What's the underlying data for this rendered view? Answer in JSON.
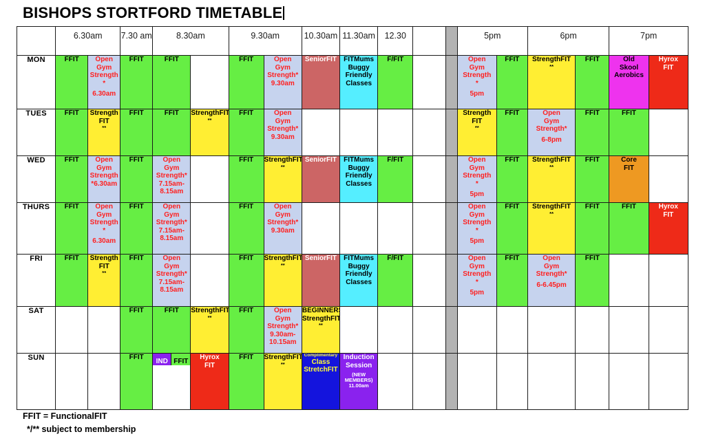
{
  "title": "BISHOPS STORTFORD TIMETABLE",
  "header": {
    "corner": "",
    "slots": [
      {
        "label": "6.30am",
        "span": 2
      },
      {
        "label": "7.30 am",
        "span": 1
      },
      {
        "label": "8.30am",
        "span": 2
      },
      {
        "label": "9.30am",
        "span": 2
      },
      {
        "label": "10.30am",
        "span": 1
      },
      {
        "label": "11.30am",
        "span": 1
      },
      {
        "label": "12.30",
        "span": 1
      },
      {
        "label": "",
        "span": 1
      },
      {
        "label": "",
        "span": 1,
        "divider": true
      },
      {
        "label": "5pm",
        "span": 2
      },
      {
        "label": "6pm",
        "span": 2
      },
      {
        "label": "7pm",
        "span": 2
      }
    ]
  },
  "colors": {
    "green": "#66ee44",
    "blue": "#c6d3ee",
    "yellow": "#ffee33",
    "rose": "#cc6565",
    "cyan": "#55eeff",
    "magenta": "#ee33ee",
    "red": "#ee2a18",
    "orange": "#ee9922",
    "purple": "#8a22ee",
    "navy": "#1414dd",
    "divider_grey": "#b3b3b3",
    "border": "#1a1a1a"
  },
  "rows": [
    {
      "day": "MON",
      "cells": [
        {
          "color": "green",
          "lines": [
            "FFIT"
          ]
        },
        {
          "color": "blue",
          "lines": [
            "Open",
            "Gym",
            "Strength",
            "*",
            "",
            "6.30am"
          ]
        },
        {
          "color": "green",
          "lines": [
            "FFIT"
          ]
        },
        {
          "color": "green",
          "lines": [
            "FFIT"
          ]
        },
        {
          "color": "white",
          "lines": []
        },
        {
          "color": "green",
          "lines": [
            "FFIT"
          ]
        },
        {
          "color": "blue",
          "lines": [
            "Open",
            "Gym",
            "Strength*",
            "9.30am"
          ]
        },
        {
          "color": "rose",
          "lines": [
            "SeniorFIT"
          ]
        },
        {
          "color": "cyan",
          "lines": [
            "FITMums",
            "Buggy",
            "Friendly",
            "Classes"
          ]
        },
        {
          "color": "green",
          "lines": [
            "F/FIT"
          ]
        },
        {
          "color": "white",
          "lines": []
        },
        {
          "divider": true
        },
        {
          "color": "blue",
          "lines": [
            "Open",
            "Gym",
            "Strength",
            "*",
            "",
            "5pm"
          ]
        },
        {
          "color": "green",
          "lines": [
            "FFIT"
          ]
        },
        {
          "color": "yellow",
          "lines": [
            "StrengthFIT"
          ],
          "sub": "**"
        },
        {
          "color": "green",
          "lines": [
            "FFIT"
          ]
        },
        {
          "color": "magenta",
          "lines": [
            "Old",
            "Skool",
            "Aerobics"
          ]
        },
        {
          "color": "red",
          "lines": [
            "Hyrox",
            "FIT"
          ]
        }
      ]
    },
    {
      "day": "TUES",
      "cells": [
        {
          "color": "green",
          "lines": [
            "FFIT"
          ]
        },
        {
          "color": "yellow",
          "lines": [
            "Strength",
            "FIT"
          ],
          "sub": "**"
        },
        {
          "color": "green",
          "lines": [
            "FFIT"
          ]
        },
        {
          "color": "green",
          "lines": [
            "FFIT"
          ]
        },
        {
          "color": "yellow",
          "lines": [
            "StrengthFIT"
          ],
          "sub": "**"
        },
        {
          "color": "green",
          "lines": [
            "FFIT"
          ]
        },
        {
          "color": "blue",
          "lines": [
            "Open",
            "Gym",
            "Strength*",
            "9.30am"
          ]
        },
        {
          "color": "white",
          "lines": []
        },
        {
          "color": "white",
          "lines": []
        },
        {
          "color": "white",
          "lines": []
        },
        {
          "color": "white",
          "lines": []
        },
        {
          "divider": true
        },
        {
          "color": "yellow",
          "lines": [
            "Strength",
            "FIT"
          ],
          "sub": "**"
        },
        {
          "color": "green",
          "lines": [
            "FFIT"
          ]
        },
        {
          "color": "blue",
          "lines": [
            "Open",
            "Gym",
            "Strength*",
            "",
            "6-8pm"
          ]
        },
        {
          "color": "green",
          "lines": [
            "FFIT"
          ]
        },
        {
          "color": "green",
          "lines": [
            "FFIT"
          ]
        },
        {
          "color": "white",
          "lines": []
        }
      ]
    },
    {
      "day": "WED",
      "cells": [
        {
          "color": "green",
          "lines": [
            "FFIT"
          ]
        },
        {
          "color": "blue",
          "lines": [
            "Open",
            "Gym",
            "Strength",
            "*6.30am"
          ]
        },
        {
          "color": "green",
          "lines": [
            "FFIT"
          ]
        },
        {
          "color": "blue",
          "lines": [
            "Open",
            "Gym",
            "Strength*",
            "7.15am-",
            "8.15am"
          ]
        },
        {
          "color": "white",
          "lines": []
        },
        {
          "color": "green",
          "lines": [
            "FFIT"
          ]
        },
        {
          "color": "yellow",
          "lines": [
            "StrengthFIT"
          ],
          "sub": "**"
        },
        {
          "color": "rose",
          "lines": [
            "SeniorFIT"
          ]
        },
        {
          "color": "cyan",
          "lines": [
            "FITMums",
            "Buggy",
            "Friendly",
            "Classes"
          ]
        },
        {
          "color": "green",
          "lines": [
            "F/FIT"
          ]
        },
        {
          "color": "white",
          "lines": []
        },
        {
          "divider": true
        },
        {
          "color": "blue",
          "lines": [
            "Open",
            "Gym",
            "Strength",
            "*",
            "",
            "5pm"
          ]
        },
        {
          "color": "green",
          "lines": [
            "FFIT"
          ]
        },
        {
          "color": "yellow",
          "lines": [
            "StrengthFIT"
          ],
          "sub": "**"
        },
        {
          "color": "green",
          "lines": [
            "FFIT"
          ]
        },
        {
          "color": "orange",
          "lines": [
            "Core",
            "FIT"
          ]
        },
        {
          "color": "white",
          "lines": []
        }
      ]
    },
    {
      "day": "THURS",
      "cells": [
        {
          "color": "green",
          "lines": [
            "FFIT"
          ]
        },
        {
          "color": "blue",
          "lines": [
            "Open",
            "Gym",
            "Strength",
            "*",
            "",
            "6.30am"
          ]
        },
        {
          "color": "green",
          "lines": [
            "FFIT"
          ]
        },
        {
          "color": "blue",
          "lines": [
            "Open",
            "Gym",
            "Strength*",
            "7.15am-",
            "8.15am"
          ]
        },
        {
          "color": "white",
          "lines": []
        },
        {
          "color": "green",
          "lines": [
            "FFIT"
          ]
        },
        {
          "color": "blue",
          "lines": [
            "Open",
            "Gym",
            "Strength*",
            "9.30am"
          ]
        },
        {
          "color": "white",
          "lines": []
        },
        {
          "color": "white",
          "lines": []
        },
        {
          "color": "white",
          "lines": []
        },
        {
          "color": "white",
          "lines": []
        },
        {
          "divider": true
        },
        {
          "color": "blue",
          "lines": [
            "Open",
            "Gym",
            "Strength",
            "*",
            "",
            "5pm"
          ]
        },
        {
          "color": "green",
          "lines": [
            "FFIT"
          ]
        },
        {
          "color": "yellow",
          "lines": [
            "StrengthFIT"
          ],
          "sub": "**"
        },
        {
          "color": "green",
          "lines": [
            "FFIT"
          ]
        },
        {
          "color": "green",
          "lines": [
            "FFIT"
          ]
        },
        {
          "color": "red",
          "lines": [
            "Hyrox",
            "FIT"
          ]
        }
      ]
    },
    {
      "day": "FRI",
      "cells": [
        {
          "color": "green",
          "lines": [
            "FFIT"
          ]
        },
        {
          "color": "yellow",
          "lines": [
            "Strength",
            "FIT"
          ],
          "sub": "**"
        },
        {
          "color": "green",
          "lines": [
            "FFIT"
          ]
        },
        {
          "color": "blue",
          "lines": [
            "Open",
            "Gym",
            "Strength*",
            "7.15am-",
            "8.15am"
          ]
        },
        {
          "color": "white",
          "lines": []
        },
        {
          "color": "green",
          "lines": [
            "FFIT"
          ]
        },
        {
          "color": "yellow",
          "lines": [
            "StrengthFIT"
          ],
          "sub": "**"
        },
        {
          "color": "rose",
          "lines": [
            "SeniorFIT"
          ]
        },
        {
          "color": "cyan",
          "lines": [
            "FITMums",
            "Buggy",
            "Friendly",
            "Classes"
          ]
        },
        {
          "color": "green",
          "lines": [
            "F/FIT"
          ]
        },
        {
          "color": "white",
          "lines": []
        },
        {
          "divider": true
        },
        {
          "color": "blue",
          "lines": [
            "Open",
            "Gym",
            "Strength",
            "*",
            "",
            "5pm"
          ]
        },
        {
          "color": "green",
          "lines": [
            "FFIT"
          ]
        },
        {
          "color": "blue",
          "lines": [
            "Open",
            "Gym",
            "Strength*",
            "",
            "6-6.45pm"
          ]
        },
        {
          "color": "green",
          "lines": [
            "FFIT"
          ]
        },
        {
          "color": "white",
          "lines": []
        },
        {
          "color": "white",
          "lines": []
        }
      ]
    },
    {
      "day": "SAT",
      "cells": [
        {
          "color": "white",
          "lines": []
        },
        {
          "color": "white",
          "lines": []
        },
        {
          "color": "green",
          "lines": [
            "FFIT"
          ]
        },
        {
          "color": "green",
          "lines": [
            "FFIT"
          ]
        },
        {
          "color": "yellow",
          "lines": [
            "StrengthFIT"
          ],
          "sub": "**"
        },
        {
          "color": "green",
          "lines": [
            "FFIT"
          ]
        },
        {
          "color": "blue",
          "lines": [
            "Open",
            "Gym",
            "Strength*",
            "9.30am-",
            "10.15am"
          ]
        },
        {
          "color": "yellow",
          "lines": [
            "BEGINNERS",
            "StrengthFIT"
          ],
          "sub": "**"
        },
        {
          "color": "white",
          "lines": []
        },
        {
          "color": "white",
          "lines": []
        },
        {
          "color": "white",
          "lines": []
        },
        {
          "divider": true
        },
        {
          "color": "white",
          "lines": []
        },
        {
          "color": "white",
          "lines": []
        },
        {
          "color": "white",
          "lines": []
        },
        {
          "color": "white",
          "lines": []
        },
        {
          "color": "white",
          "lines": []
        },
        {
          "color": "white",
          "lines": []
        }
      ]
    },
    {
      "day": "SUN",
      "cells": [
        {
          "color": "white",
          "lines": []
        },
        {
          "color": "white",
          "lines": []
        },
        {
          "color": "green",
          "lines": [
            "FFIT"
          ]
        },
        {
          "split": true,
          "left": {
            "color": "purple",
            "label": "IND"
          },
          "right": {
            "color": "green",
            "label": "FFIT"
          }
        },
        {
          "color": "red",
          "lines": [
            "Hyrox",
            "FIT"
          ]
        },
        {
          "color": "green",
          "lines": [
            "FFIT"
          ]
        },
        {
          "color": "yellow",
          "lines": [
            "StrengthFIT"
          ],
          "sub": "**"
        },
        {
          "color": "navy",
          "lines": [
            "Complimentary",
            "Class",
            "StretchFIT"
          ],
          "tinyFirst": true
        },
        {
          "color": "purple",
          "lines": [
            "Induction",
            "Session",
            "",
            "(NEW",
            "MEMBERS)",
            "11.00am"
          ],
          "smallTail": 3
        },
        {
          "color": "white",
          "lines": []
        },
        {
          "color": "white",
          "lines": []
        },
        {
          "divider": true
        },
        {
          "color": "white",
          "lines": []
        },
        {
          "color": "white",
          "lines": []
        },
        {
          "color": "white",
          "lines": []
        },
        {
          "color": "white",
          "lines": []
        },
        {
          "color": "white",
          "lines": []
        },
        {
          "color": "white",
          "lines": []
        }
      ]
    }
  ],
  "footer": {
    "line1": "FFIT = FunctionalFIT",
    "line2": "*/** subject to membership"
  }
}
